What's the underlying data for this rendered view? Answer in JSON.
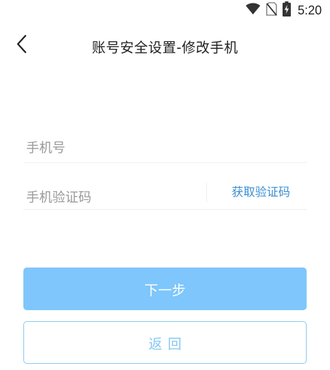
{
  "status_bar": {
    "time": "5:20",
    "icons": [
      "wifi-icon",
      "no-sim-icon",
      "battery-charging-icon"
    ]
  },
  "header": {
    "back_icon": "chevron-left-icon",
    "title": "账号安全设置-修改手机"
  },
  "form": {
    "phone": {
      "placeholder": "手机号",
      "value": ""
    },
    "code": {
      "placeholder": "手机验证码",
      "value": "",
      "get_code_label": "获取验证码"
    }
  },
  "actions": {
    "next_label": "下一步",
    "back_label": "返回"
  },
  "colors": {
    "primary": "#7ec6fb",
    "link": "#3a8fd3",
    "outline": "#86c8f5",
    "placeholder": "#9a9a9a"
  }
}
